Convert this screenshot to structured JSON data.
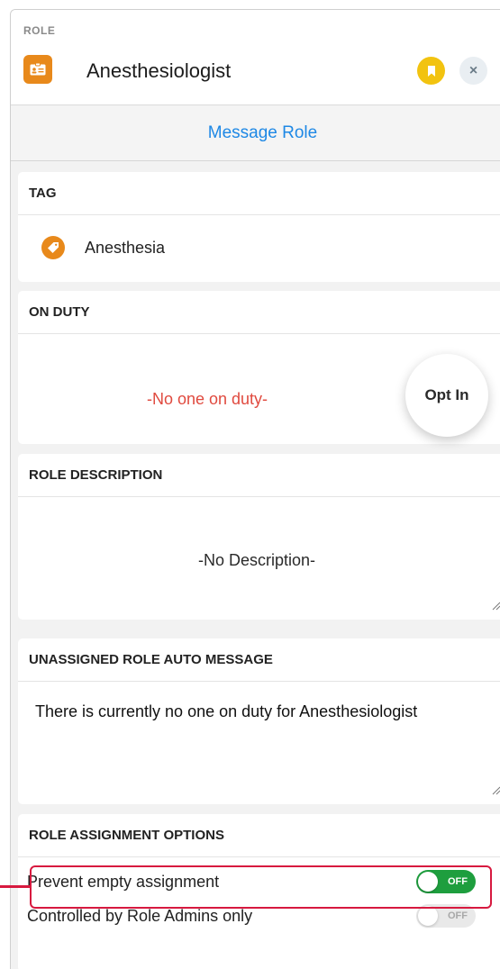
{
  "header": {
    "kicker": "ROLE",
    "title": "Anesthesiologist",
    "role_icon": "id-card-icon",
    "bookmark_icon": "bookmark-icon",
    "close_icon": "close-icon",
    "close_glyph": "×"
  },
  "message_role": {
    "label": "Message Role"
  },
  "tag": {
    "title": "TAG",
    "icon": "tag-icon",
    "label": "Anesthesia"
  },
  "on_duty": {
    "title": "ON DUTY",
    "empty_text": "-No one on duty-",
    "opt_in_label": "Opt In"
  },
  "role_description": {
    "title": "ROLE DESCRIPTION",
    "text": "-No Description-"
  },
  "auto_message": {
    "title": "UNASSIGNED ROLE AUTO MESSAGE",
    "text": "There is currently no one on duty for Anesthesiologist"
  },
  "assignment_options": {
    "title": "ROLE ASSIGNMENT OPTIONS",
    "items": [
      {
        "label": "Prevent empty assignment",
        "toggle_text": "OFF"
      },
      {
        "label": "Controlled by Role Admins only",
        "toggle_text": "OFF"
      }
    ]
  },
  "colors": {
    "accent_orange": "#e8891b",
    "link_blue": "#1e88e5",
    "empty_red": "#e04a3f",
    "toggle_green": "#1e9e3e",
    "highlight_red": "#d7193f",
    "bookmark_yellow": "#f2c310"
  }
}
